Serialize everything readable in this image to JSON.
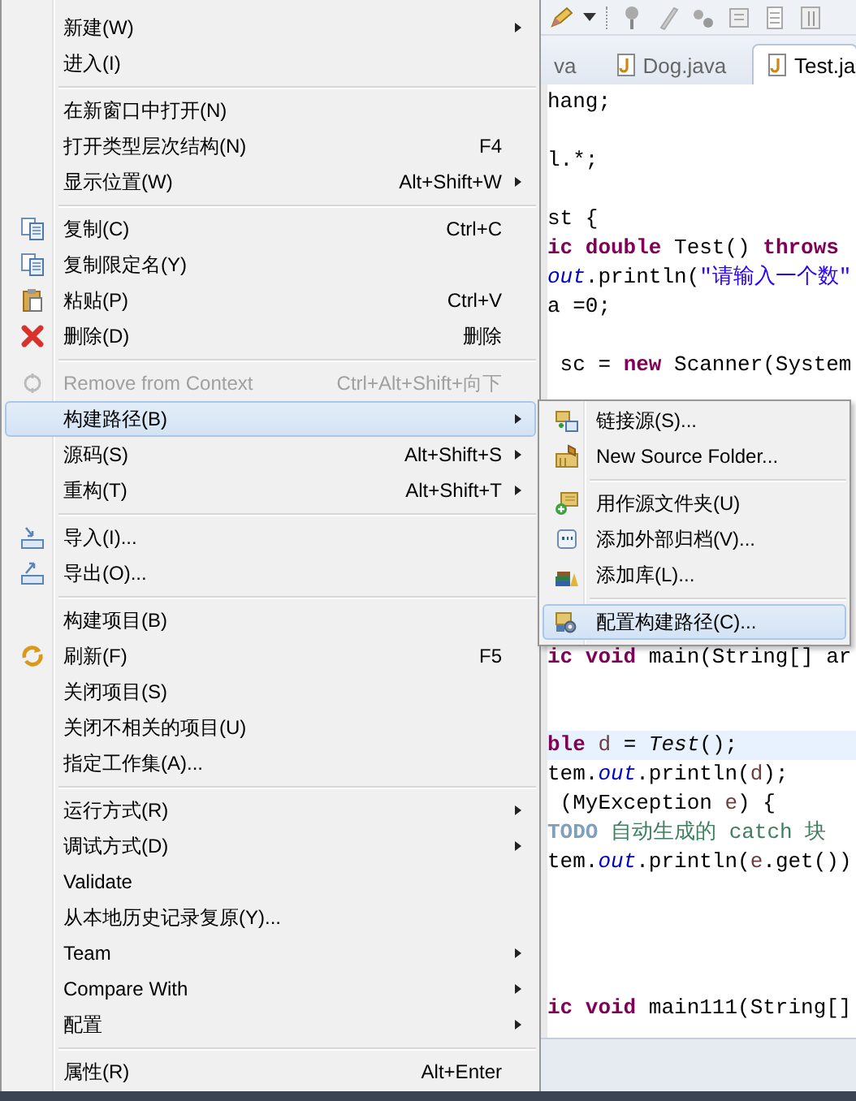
{
  "context_menu": {
    "items": [
      {
        "kind": "item",
        "label": "新建(W)",
        "submenu": true
      },
      {
        "kind": "item",
        "label": "进入(I)"
      },
      {
        "kind": "separator"
      },
      {
        "kind": "item",
        "label": "在新窗口中打开(N)"
      },
      {
        "kind": "item",
        "label": "打开类型层次结构(N)",
        "shortcut": "F4"
      },
      {
        "kind": "item",
        "label": "显示位置(W)",
        "shortcut": "Alt+Shift+W",
        "submenu": true
      },
      {
        "kind": "separator"
      },
      {
        "kind": "item",
        "label": "复制(C)",
        "shortcut": "Ctrl+C"
      },
      {
        "kind": "item",
        "label": "复制限定名(Y)"
      },
      {
        "kind": "item",
        "label": "粘贴(P)",
        "shortcut": "Ctrl+V"
      },
      {
        "kind": "item",
        "label": "删除(D)",
        "shortcut": "删除"
      },
      {
        "kind": "separator"
      },
      {
        "kind": "item",
        "label": "Remove from Context",
        "shortcut": "Ctrl+Alt+Shift+向下",
        "disabled": true
      },
      {
        "kind": "item",
        "label": "构建路径(B)",
        "submenu": true,
        "selected": true
      },
      {
        "kind": "item",
        "label": "源码(S)",
        "shortcut": "Alt+Shift+S",
        "submenu": true
      },
      {
        "kind": "item",
        "label": "重构(T)",
        "shortcut": "Alt+Shift+T",
        "submenu": true
      },
      {
        "kind": "separator"
      },
      {
        "kind": "item",
        "label": "导入(I)..."
      },
      {
        "kind": "item",
        "label": "导出(O)..."
      },
      {
        "kind": "separator"
      },
      {
        "kind": "item",
        "label": "构建项目(B)"
      },
      {
        "kind": "item",
        "label": "刷新(F)",
        "shortcut": "F5"
      },
      {
        "kind": "item",
        "label": "关闭项目(S)"
      },
      {
        "kind": "item",
        "label": "关闭不相关的项目(U)"
      },
      {
        "kind": "item",
        "label": "指定工作集(A)..."
      },
      {
        "kind": "separator"
      },
      {
        "kind": "item",
        "label": "运行方式(R)",
        "submenu": true
      },
      {
        "kind": "item",
        "label": "调试方式(D)",
        "submenu": true
      },
      {
        "kind": "item",
        "label": "Validate"
      },
      {
        "kind": "item",
        "label": "从本地历史记录复原(Y)..."
      },
      {
        "kind": "item",
        "label": "Team",
        "submenu": true
      },
      {
        "kind": "item",
        "label": "Compare With",
        "submenu": true
      },
      {
        "kind": "item",
        "label": "配置",
        "submenu": true
      },
      {
        "kind": "separator"
      },
      {
        "kind": "item",
        "label": "属性(R)",
        "shortcut": "Alt+Enter"
      }
    ]
  },
  "submenu": {
    "items": [
      {
        "kind": "item",
        "label": "链接源(S)..."
      },
      {
        "kind": "item",
        "label": "New Source Folder..."
      },
      {
        "kind": "separator"
      },
      {
        "kind": "item",
        "label": "用作源文件夹(U)"
      },
      {
        "kind": "item",
        "label": "添加外部归档(V)..."
      },
      {
        "kind": "item",
        "label": "添加库(L)..."
      },
      {
        "kind": "separator"
      },
      {
        "kind": "item",
        "label": "配置构建路径(C)...",
        "selected": true
      }
    ]
  },
  "editor": {
    "tabs": [
      {
        "label": "va",
        "selected": false
      },
      {
        "label": "Dog.java",
        "selected": false
      },
      {
        "label": "Test.ja",
        "selected": true
      }
    ],
    "lines": [
      {
        "kind": "code",
        "current": false,
        "tokens": [
          {
            "kind": "plain",
            "text": "hang;"
          }
        ]
      },
      {
        "kind": "blank"
      },
      {
        "kind": "code",
        "current": false,
        "tokens": [
          {
            "kind": "plain",
            "text": "l.*;"
          }
        ]
      },
      {
        "kind": "blank"
      },
      {
        "kind": "code",
        "current": false,
        "tokens": [
          {
            "kind": "plain",
            "text": "st {"
          }
        ]
      },
      {
        "kind": "code",
        "current": false,
        "tokens": [
          {
            "kind": "keyword",
            "text": "ic double"
          },
          {
            "kind": "plain",
            "text": " Test() "
          },
          {
            "kind": "keyword",
            "text": "throws"
          }
        ]
      },
      {
        "kind": "code",
        "current": false,
        "tokens": [
          {
            "kind": "field",
            "text": "out"
          },
          {
            "kind": "plain",
            "text": ".println("
          },
          {
            "kind": "string",
            "text": "\"请输入一个数\""
          }
        ]
      },
      {
        "kind": "code",
        "current": false,
        "tokens": [
          {
            "kind": "plain",
            "text": "a =0;"
          }
        ]
      },
      {
        "kind": "blank"
      },
      {
        "kind": "code",
        "current": false,
        "tokens": [
          {
            "kind": "plain",
            "text": " sc = "
          },
          {
            "kind": "keyword",
            "text": "new"
          },
          {
            "kind": "plain",
            "text": " Scanner(System"
          }
        ]
      },
      {
        "kind": "blank"
      },
      {
        "kind": "blank"
      },
      {
        "kind": "blank"
      },
      {
        "kind": "blank"
      },
      {
        "kind": "blank"
      },
      {
        "kind": "blank"
      },
      {
        "kind": "blank"
      },
      {
        "kind": "blank"
      },
      {
        "kind": "blank"
      },
      {
        "kind": "code",
        "current": false,
        "tokens": [
          {
            "kind": "keyword",
            "text": "ic void"
          },
          {
            "kind": "plain",
            "text": " main(String[] ar"
          }
        ]
      },
      {
        "kind": "blank"
      },
      {
        "kind": "blank"
      },
      {
        "kind": "code",
        "current": true,
        "tokens": [
          {
            "kind": "keyword",
            "text": "ble"
          },
          {
            "kind": "variable",
            "text": " d"
          },
          {
            "kind": "plain",
            "text": " = "
          },
          {
            "kind": "static",
            "text": "Test"
          },
          {
            "kind": "plain",
            "text": "();"
          }
        ]
      },
      {
        "kind": "code",
        "current": false,
        "tokens": [
          {
            "kind": "plain",
            "text": "tem."
          },
          {
            "kind": "field",
            "text": "out"
          },
          {
            "kind": "plain",
            "text": ".println("
          },
          {
            "kind": "variable",
            "text": "d"
          },
          {
            "kind": "plain",
            "text": ");"
          }
        ]
      },
      {
        "kind": "code",
        "current": false,
        "tokens": [
          {
            "kind": "plain",
            "text": " (MyException "
          },
          {
            "kind": "variable",
            "text": "e"
          },
          {
            "kind": "plain",
            "text": ") {"
          }
        ]
      },
      {
        "kind": "code",
        "current": false,
        "tokens": [
          {
            "kind": "todo",
            "text": "TODO"
          },
          {
            "kind": "comment",
            "text": " 自动生成的 catch 块"
          }
        ]
      },
      {
        "kind": "code",
        "current": false,
        "tokens": [
          {
            "kind": "plain",
            "text": "tem."
          },
          {
            "kind": "field",
            "text": "out"
          },
          {
            "kind": "plain",
            "text": ".println("
          },
          {
            "kind": "variable",
            "text": "e"
          },
          {
            "kind": "plain",
            "text": ".get())"
          }
        ]
      },
      {
        "kind": "blank"
      },
      {
        "kind": "blank"
      },
      {
        "kind": "blank"
      },
      {
        "kind": "blank"
      },
      {
        "kind": "code",
        "current": false,
        "tokens": [
          {
            "kind": "keyword",
            "text": "ic void"
          },
          {
            "kind": "plain",
            "text": " main111(String[]"
          }
        ]
      }
    ]
  }
}
